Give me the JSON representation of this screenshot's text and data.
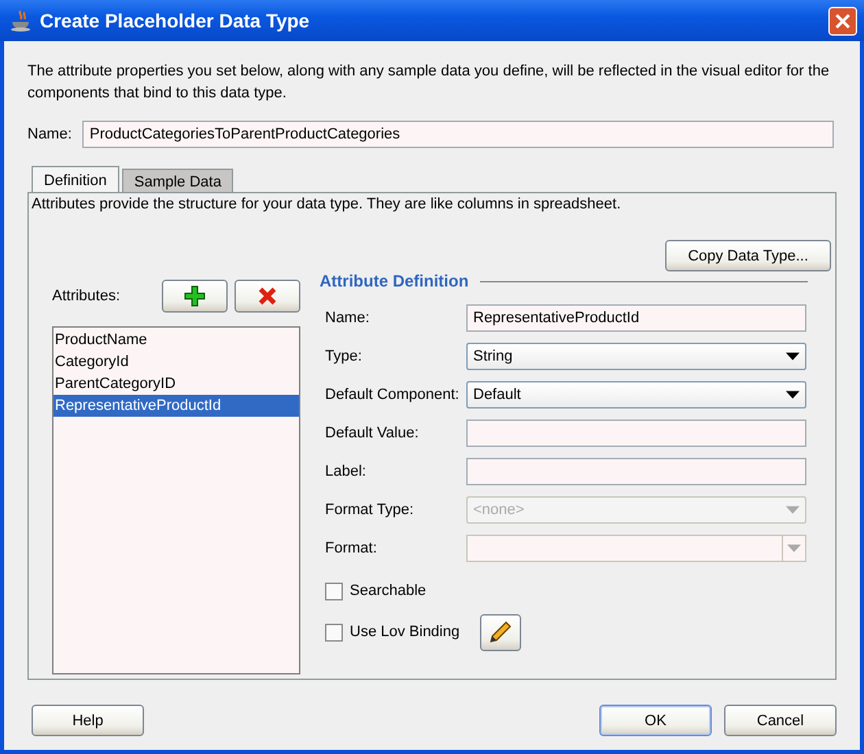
{
  "window": {
    "title": "Create Placeholder Data Type"
  },
  "description": "The attribute properties you set below, along with any sample data you define, will be reflected in the visual editor for the components that bind to this data type.",
  "name_field": {
    "label": "Name:",
    "value": "ProductCategoriesToParentProductCategories"
  },
  "tabs": [
    {
      "label": "Definition",
      "selected": true
    },
    {
      "label": "Sample Data",
      "selected": false
    }
  ],
  "tab_description": "Attributes provide the structure for your data type. They are like columns in spreadsheet.",
  "copy_button": "Copy Data Type...",
  "attributes": {
    "label": "Attributes:",
    "items": [
      {
        "label": "ProductName",
        "selected": false
      },
      {
        "label": "CategoryId",
        "selected": false
      },
      {
        "label": "ParentCategoryID",
        "selected": false
      },
      {
        "label": "RepresentativeProductId",
        "selected": true
      }
    ]
  },
  "attribute_definition": {
    "title": "Attribute Definition",
    "fields": [
      {
        "kind": "text",
        "label": "Name:",
        "value": "RepresentativeProductId",
        "disabled": false
      },
      {
        "kind": "select",
        "label": "Type:",
        "value": "String",
        "disabled": false
      },
      {
        "kind": "select",
        "label": "Default Component:",
        "value": "Default",
        "disabled": false
      },
      {
        "kind": "text",
        "label": "Default Value:",
        "disabled": false
      },
      {
        "kind": "text",
        "label": "Label:",
        "disabled": false
      },
      {
        "kind": "select",
        "label": "Format Type:",
        "value": "<none>",
        "disabled": true
      },
      {
        "kind": "combo",
        "label": "Format:",
        "disabled": true
      }
    ],
    "checkboxes": [
      {
        "label": "Searchable",
        "checked": false
      },
      {
        "label": "Use Lov Binding",
        "checked": false
      }
    ]
  },
  "buttons": [
    {
      "label": "Help",
      "kind": "help"
    },
    {
      "label": "OK",
      "kind": "ok"
    },
    {
      "label": "Cancel",
      "kind": "cancel"
    }
  ]
}
